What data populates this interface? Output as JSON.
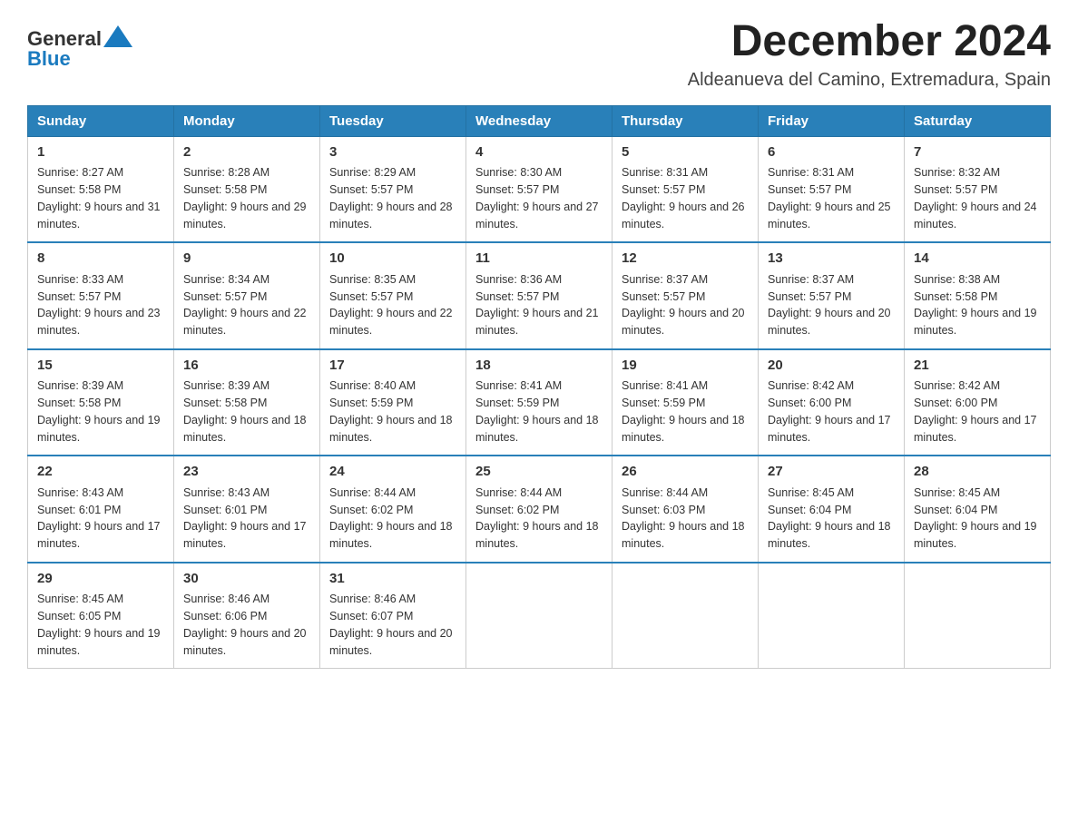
{
  "header": {
    "logo_general": "General",
    "logo_blue": "Blue",
    "month_year": "December 2024",
    "location": "Aldeanueva del Camino, Extremadura, Spain"
  },
  "days_of_week": [
    "Sunday",
    "Monday",
    "Tuesday",
    "Wednesday",
    "Thursday",
    "Friday",
    "Saturday"
  ],
  "weeks": [
    [
      {
        "day": "1",
        "sunrise": "Sunrise: 8:27 AM",
        "sunset": "Sunset: 5:58 PM",
        "daylight": "Daylight: 9 hours and 31 minutes."
      },
      {
        "day": "2",
        "sunrise": "Sunrise: 8:28 AM",
        "sunset": "Sunset: 5:58 PM",
        "daylight": "Daylight: 9 hours and 29 minutes."
      },
      {
        "day": "3",
        "sunrise": "Sunrise: 8:29 AM",
        "sunset": "Sunset: 5:57 PM",
        "daylight": "Daylight: 9 hours and 28 minutes."
      },
      {
        "day": "4",
        "sunrise": "Sunrise: 8:30 AM",
        "sunset": "Sunset: 5:57 PM",
        "daylight": "Daylight: 9 hours and 27 minutes."
      },
      {
        "day": "5",
        "sunrise": "Sunrise: 8:31 AM",
        "sunset": "Sunset: 5:57 PM",
        "daylight": "Daylight: 9 hours and 26 minutes."
      },
      {
        "day": "6",
        "sunrise": "Sunrise: 8:31 AM",
        "sunset": "Sunset: 5:57 PM",
        "daylight": "Daylight: 9 hours and 25 minutes."
      },
      {
        "day": "7",
        "sunrise": "Sunrise: 8:32 AM",
        "sunset": "Sunset: 5:57 PM",
        "daylight": "Daylight: 9 hours and 24 minutes."
      }
    ],
    [
      {
        "day": "8",
        "sunrise": "Sunrise: 8:33 AM",
        "sunset": "Sunset: 5:57 PM",
        "daylight": "Daylight: 9 hours and 23 minutes."
      },
      {
        "day": "9",
        "sunrise": "Sunrise: 8:34 AM",
        "sunset": "Sunset: 5:57 PM",
        "daylight": "Daylight: 9 hours and 22 minutes."
      },
      {
        "day": "10",
        "sunrise": "Sunrise: 8:35 AM",
        "sunset": "Sunset: 5:57 PM",
        "daylight": "Daylight: 9 hours and 22 minutes."
      },
      {
        "day": "11",
        "sunrise": "Sunrise: 8:36 AM",
        "sunset": "Sunset: 5:57 PM",
        "daylight": "Daylight: 9 hours and 21 minutes."
      },
      {
        "day": "12",
        "sunrise": "Sunrise: 8:37 AM",
        "sunset": "Sunset: 5:57 PM",
        "daylight": "Daylight: 9 hours and 20 minutes."
      },
      {
        "day": "13",
        "sunrise": "Sunrise: 8:37 AM",
        "sunset": "Sunset: 5:57 PM",
        "daylight": "Daylight: 9 hours and 20 minutes."
      },
      {
        "day": "14",
        "sunrise": "Sunrise: 8:38 AM",
        "sunset": "Sunset: 5:58 PM",
        "daylight": "Daylight: 9 hours and 19 minutes."
      }
    ],
    [
      {
        "day": "15",
        "sunrise": "Sunrise: 8:39 AM",
        "sunset": "Sunset: 5:58 PM",
        "daylight": "Daylight: 9 hours and 19 minutes."
      },
      {
        "day": "16",
        "sunrise": "Sunrise: 8:39 AM",
        "sunset": "Sunset: 5:58 PM",
        "daylight": "Daylight: 9 hours and 18 minutes."
      },
      {
        "day": "17",
        "sunrise": "Sunrise: 8:40 AM",
        "sunset": "Sunset: 5:59 PM",
        "daylight": "Daylight: 9 hours and 18 minutes."
      },
      {
        "day": "18",
        "sunrise": "Sunrise: 8:41 AM",
        "sunset": "Sunset: 5:59 PM",
        "daylight": "Daylight: 9 hours and 18 minutes."
      },
      {
        "day": "19",
        "sunrise": "Sunrise: 8:41 AM",
        "sunset": "Sunset: 5:59 PM",
        "daylight": "Daylight: 9 hours and 18 minutes."
      },
      {
        "day": "20",
        "sunrise": "Sunrise: 8:42 AM",
        "sunset": "Sunset: 6:00 PM",
        "daylight": "Daylight: 9 hours and 17 minutes."
      },
      {
        "day": "21",
        "sunrise": "Sunrise: 8:42 AM",
        "sunset": "Sunset: 6:00 PM",
        "daylight": "Daylight: 9 hours and 17 minutes."
      }
    ],
    [
      {
        "day": "22",
        "sunrise": "Sunrise: 8:43 AM",
        "sunset": "Sunset: 6:01 PM",
        "daylight": "Daylight: 9 hours and 17 minutes."
      },
      {
        "day": "23",
        "sunrise": "Sunrise: 8:43 AM",
        "sunset": "Sunset: 6:01 PM",
        "daylight": "Daylight: 9 hours and 17 minutes."
      },
      {
        "day": "24",
        "sunrise": "Sunrise: 8:44 AM",
        "sunset": "Sunset: 6:02 PM",
        "daylight": "Daylight: 9 hours and 18 minutes."
      },
      {
        "day": "25",
        "sunrise": "Sunrise: 8:44 AM",
        "sunset": "Sunset: 6:02 PM",
        "daylight": "Daylight: 9 hours and 18 minutes."
      },
      {
        "day": "26",
        "sunrise": "Sunrise: 8:44 AM",
        "sunset": "Sunset: 6:03 PM",
        "daylight": "Daylight: 9 hours and 18 minutes."
      },
      {
        "day": "27",
        "sunrise": "Sunrise: 8:45 AM",
        "sunset": "Sunset: 6:04 PM",
        "daylight": "Daylight: 9 hours and 18 minutes."
      },
      {
        "day": "28",
        "sunrise": "Sunrise: 8:45 AM",
        "sunset": "Sunset: 6:04 PM",
        "daylight": "Daylight: 9 hours and 19 minutes."
      }
    ],
    [
      {
        "day": "29",
        "sunrise": "Sunrise: 8:45 AM",
        "sunset": "Sunset: 6:05 PM",
        "daylight": "Daylight: 9 hours and 19 minutes."
      },
      {
        "day": "30",
        "sunrise": "Sunrise: 8:46 AM",
        "sunset": "Sunset: 6:06 PM",
        "daylight": "Daylight: 9 hours and 20 minutes."
      },
      {
        "day": "31",
        "sunrise": "Sunrise: 8:46 AM",
        "sunset": "Sunset: 6:07 PM",
        "daylight": "Daylight: 9 hours and 20 minutes."
      },
      null,
      null,
      null,
      null
    ]
  ]
}
